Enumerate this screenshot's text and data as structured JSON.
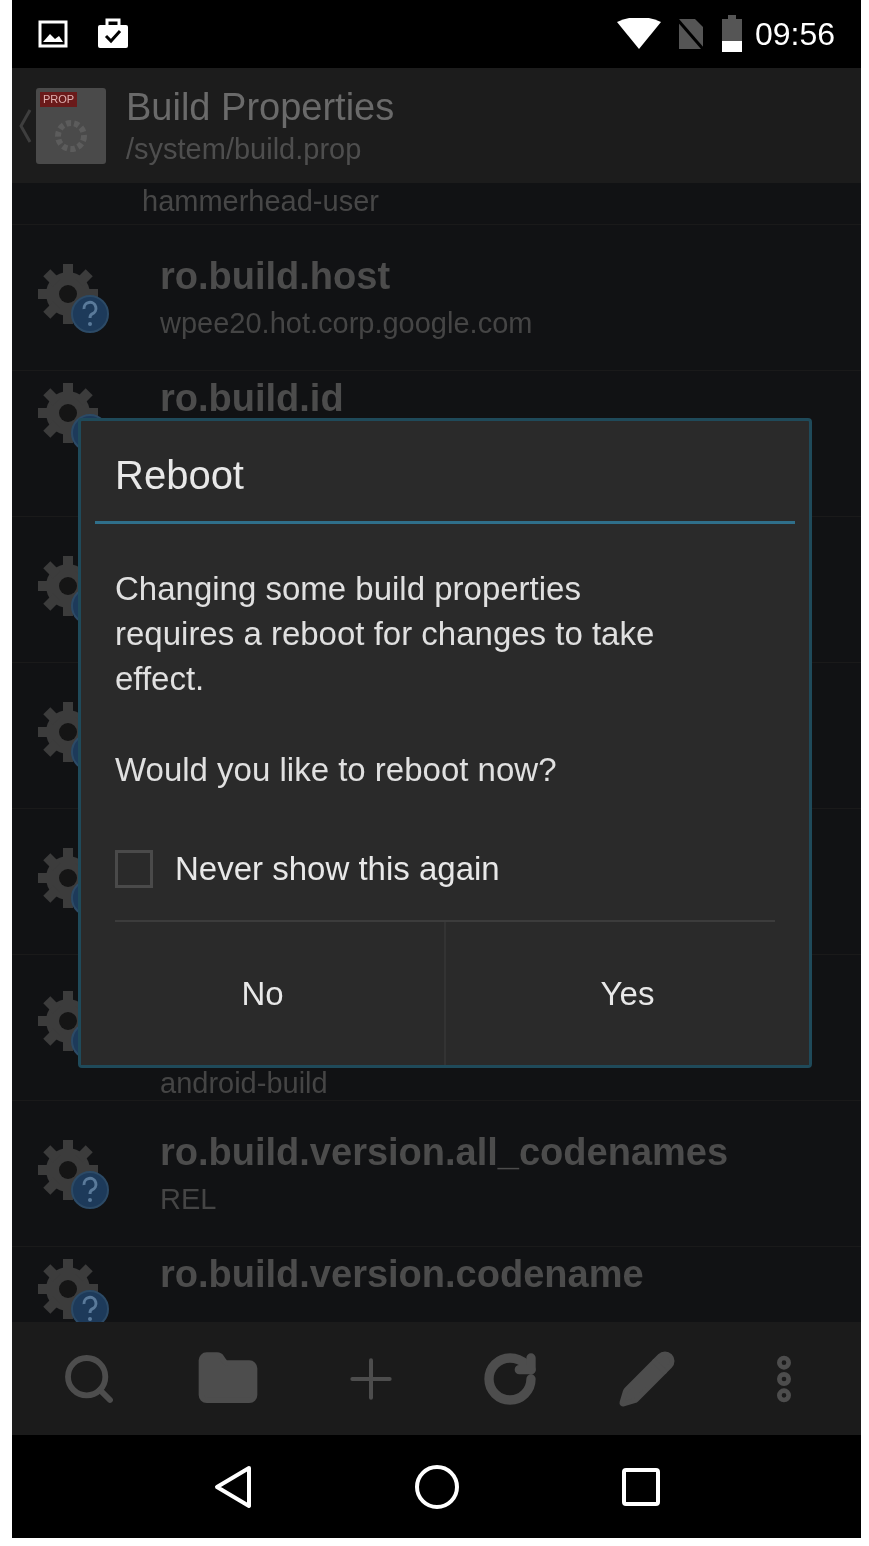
{
  "status_bar": {
    "time": "09:56"
  },
  "header": {
    "icon_tag": "PROP",
    "title": "Build Properties",
    "subtitle": "/system/build.prop"
  },
  "properties": [
    {
      "kind": "cut_top",
      "value": "hammerhead-user"
    },
    {
      "kind": "full",
      "name": "ro.build.host",
      "value": "wpee20.hot.corp.google.com"
    },
    {
      "kind": "name_only",
      "name": "ro.build.id"
    },
    {
      "kind": "covered"
    },
    {
      "kind": "covered"
    },
    {
      "kind": "covered"
    },
    {
      "kind": "value_only",
      "value": "android-build"
    },
    {
      "kind": "full",
      "name": "ro.build.version.all_codenames",
      "value": "REL"
    },
    {
      "kind": "name_only",
      "name": "ro.build.version.codename"
    }
  ],
  "dialog": {
    "title": "Reboot",
    "message": "Changing some build properties requires a reboot for changes to take effect.",
    "question": "Would you like to reboot now?",
    "checkbox": {
      "label": "Never show this again",
      "checked": false
    },
    "buttons": [
      "No",
      "Yes"
    ]
  }
}
